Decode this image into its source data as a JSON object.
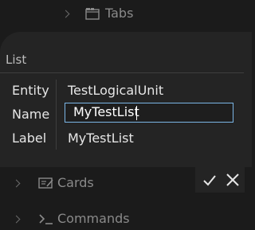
{
  "tree": {
    "tabs": {
      "label": "Tabs",
      "icon": "folder-tabs-icon"
    },
    "cards": {
      "label": "Cards",
      "icon": "card-edit-icon"
    },
    "commands": {
      "label": "Commands",
      "icon": "terminal-icon"
    }
  },
  "dialog": {
    "title": "List",
    "fields": {
      "entity": {
        "label": "Entity",
        "value": "TestLogicalUnit"
      },
      "name": {
        "label": "Name",
        "value": "MyTestList"
      },
      "label": {
        "label": "Label",
        "value": "MyTestList"
      }
    },
    "actions": {
      "confirm_icon": "checkmark-icon",
      "cancel_icon": "close-icon"
    }
  },
  "colors": {
    "background": "#1b1b1b",
    "dialog": "#242424",
    "input_border": "#7bb6e6"
  }
}
